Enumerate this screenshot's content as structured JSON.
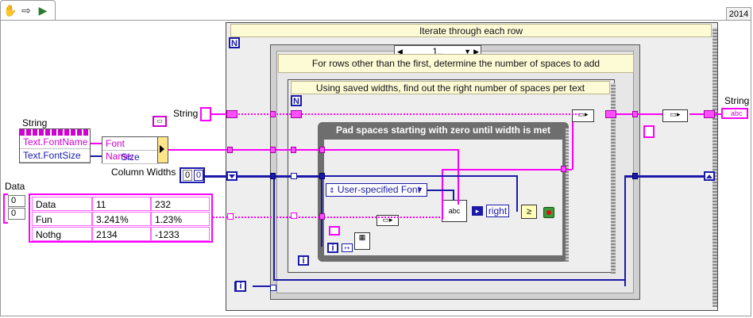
{
  "version": "2014",
  "toolbar": {
    "icons": [
      "hand-icon",
      "arrow-icon",
      "run-icon"
    ]
  },
  "outer_loop": {
    "title": "Iterate through each row",
    "n_label": "N",
    "i_label": "i"
  },
  "case_structure": {
    "selector": "1..",
    "title": "For rows other than the first, determine the number of spaces to add"
  },
  "inner_loop": {
    "title": "Using saved widths, find out the right number of spaces per text",
    "n_label": "N",
    "i_label": "i"
  },
  "while_loop": {
    "title": "Pad spaces starting with zero until width is met",
    "font_enum": "User-specified Font",
    "justify_label": "right",
    "i_label": "i"
  },
  "property_node": {
    "header": "String",
    "items": [
      "Text.FontName",
      "Text.FontSize"
    ]
  },
  "bundle": {
    "items": [
      "Font Name:",
      "Size"
    ]
  },
  "string_control": {
    "label": "String"
  },
  "string_indicator": {
    "label": "String",
    "terminal_text": "abc"
  },
  "column_widths": {
    "label": "Column Widths",
    "index": "0",
    "value": "0"
  },
  "data_control": {
    "label": "Data",
    "row_index": "0",
    "col_index": "0",
    "rows": [
      [
        "Data",
        "11",
        "232"
      ],
      [
        "Fun",
        "3.241%",
        "1.23%"
      ],
      [
        "Nothg",
        "2134",
        "-1233"
      ]
    ]
  },
  "i_terminal_bottom": "i",
  "colors": {
    "string_wire": "#ff00ff",
    "numeric_wire": "#1a1aa8",
    "banner_bg": "#fdfbd6",
    "dark_frame": "#6e6e6e"
  }
}
